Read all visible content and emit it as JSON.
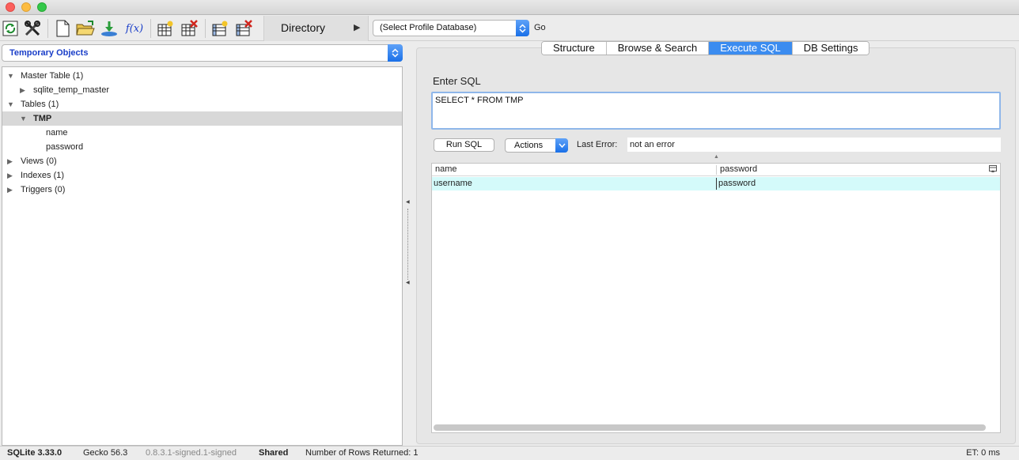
{
  "toolbar": {
    "directory_label": "Directory",
    "profile_select_value": "(Select Profile Database)",
    "go_label": "Go",
    "icons": [
      "refresh-icon",
      "tools-icon",
      "new-file-icon",
      "open-folder-icon",
      "import-icon",
      "function-icon",
      "new-table-icon",
      "delete-table-icon",
      "new-index-icon",
      "delete-index-icon"
    ],
    "function_glyph": "f(x)"
  },
  "left": {
    "object_select_value": "Temporary Objects",
    "tree": [
      {
        "label": "Master Table (1)",
        "expanded": true
      },
      {
        "label": "sqlite_temp_master",
        "expanded": false
      },
      {
        "label": "Tables (1)",
        "expanded": true
      },
      {
        "label": "TMP",
        "expanded": true,
        "selected": true
      },
      {
        "label": "name"
      },
      {
        "label": "password"
      },
      {
        "label": "Views (0)",
        "expanded": false
      },
      {
        "label": "Indexes (1)",
        "expanded": false
      },
      {
        "label": "Triggers (0)",
        "expanded": false
      }
    ]
  },
  "tabs": [
    {
      "label": "Structure"
    },
    {
      "label": "Browse & Search"
    },
    {
      "label": "Execute SQL",
      "active": true
    },
    {
      "label": "DB Settings"
    }
  ],
  "sql": {
    "enter_label": "Enter SQL",
    "query": "SELECT * FROM TMP",
    "run_label": "Run SQL",
    "actions_label": "Actions",
    "last_error_label": "Last Error:",
    "last_error_value": "not an error"
  },
  "results": {
    "columns": [
      "name",
      "password"
    ],
    "rows": [
      [
        "username",
        "password"
      ]
    ]
  },
  "status": {
    "sqlite_version": "SQLite 3.33.0",
    "gecko_version": "Gecko 56.3",
    "build": "0.8.3.1-signed.1-signed",
    "mode": "Shared",
    "rows_returned": "Number of Rows Returned: 1",
    "elapsed": "ET: 0 ms"
  },
  "colors": {
    "accent": "#3b8cf0",
    "selected_row": "#d4fafa",
    "tree_selection": "#d8d8d8",
    "object_select_text": "#1a3ec8"
  }
}
